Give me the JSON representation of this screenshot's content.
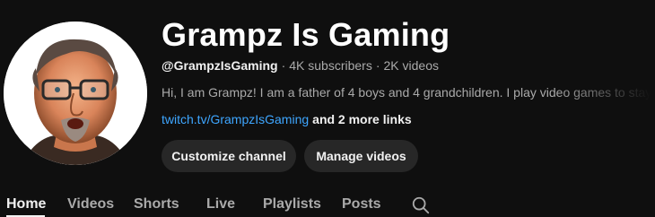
{
  "channel": {
    "name": "Grampz Is Gaming",
    "handle": "@GrampzIsGaming",
    "subscribers": "4K subscribers",
    "videos": "2K videos",
    "separator": "·",
    "description": "Hi, I am Grampz! I am a father of 4 boys and 4 grandchildren. I play video games to stay",
    "link": "twitch.tv/GrampzIsGaming",
    "more_links": "and 2 more links"
  },
  "buttons": {
    "customize": "Customize channel",
    "manage": "Manage videos"
  },
  "tabs": [
    {
      "label": "Home",
      "active": true
    },
    {
      "label": "Videos",
      "active": false
    },
    {
      "label": "Shorts",
      "active": false
    },
    {
      "label": "Live",
      "active": false
    },
    {
      "label": "Playlists",
      "active": false
    },
    {
      "label": "Posts",
      "active": false
    }
  ],
  "icons": {
    "search": "search-icon",
    "avatar": "avatar"
  },
  "colors": {
    "background": "#0f0f0f",
    "text_primary": "#f1f1f1",
    "text_secondary": "#aaaaaa",
    "link": "#3ea6ff",
    "button_bg": "#272727"
  }
}
